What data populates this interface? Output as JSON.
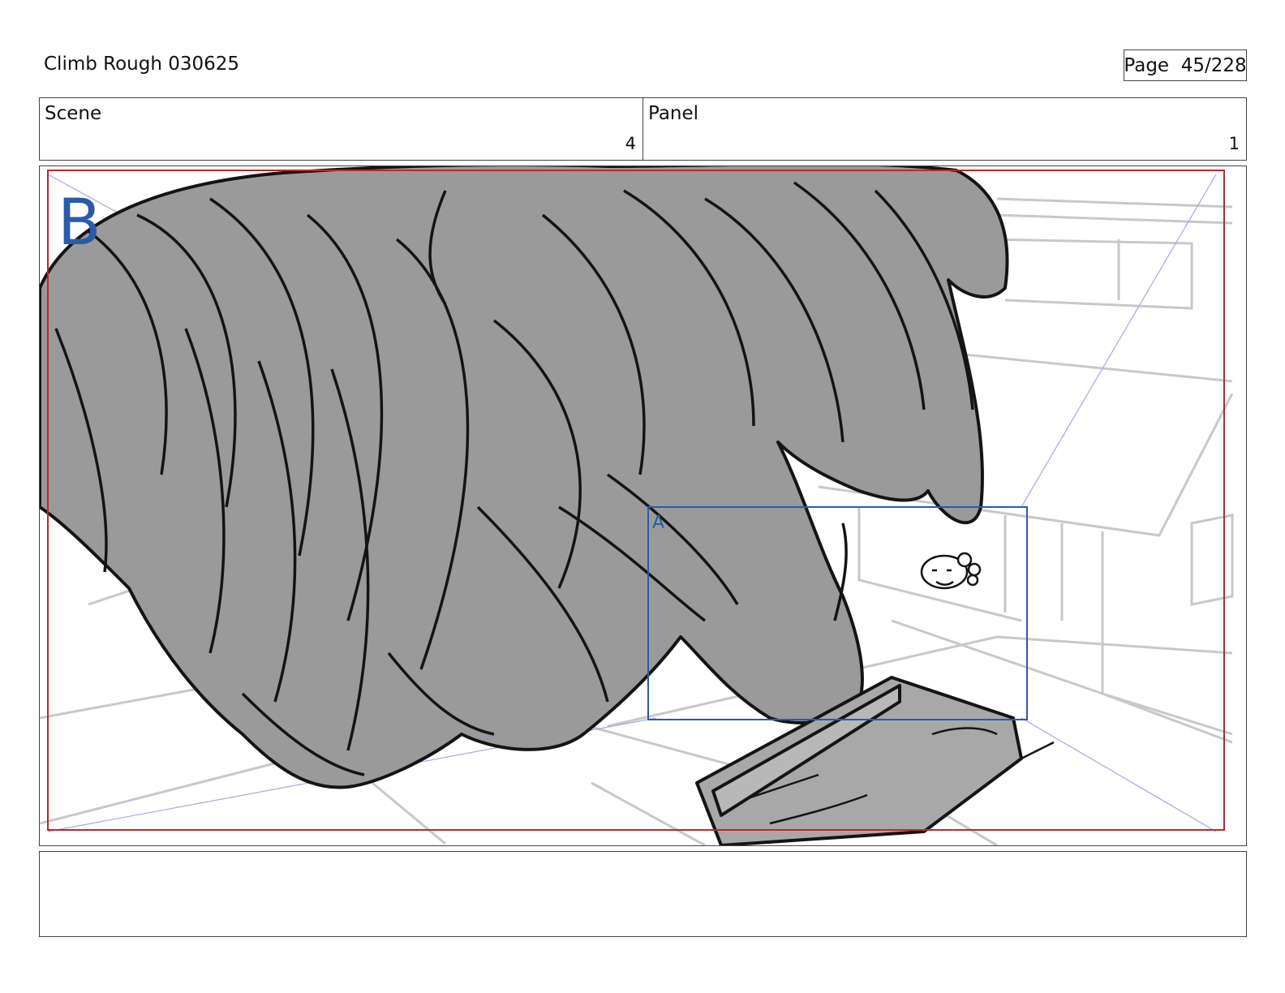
{
  "header": {
    "title": "Climb Rough 030625",
    "page_word": "Page",
    "page_number": "45/228"
  },
  "info": {
    "scene_label": "Scene",
    "scene_value": "4",
    "panel_label": "Panel",
    "panel_value": "1"
  },
  "frame": {
    "camera_b_label": "B",
    "camera_a_label": "A",
    "outer_frame_color": "#c0262d",
    "inner_frame_color": "#2b5aa8",
    "fur_color": "#9a9a9a"
  },
  "notes": {
    "text": ""
  }
}
